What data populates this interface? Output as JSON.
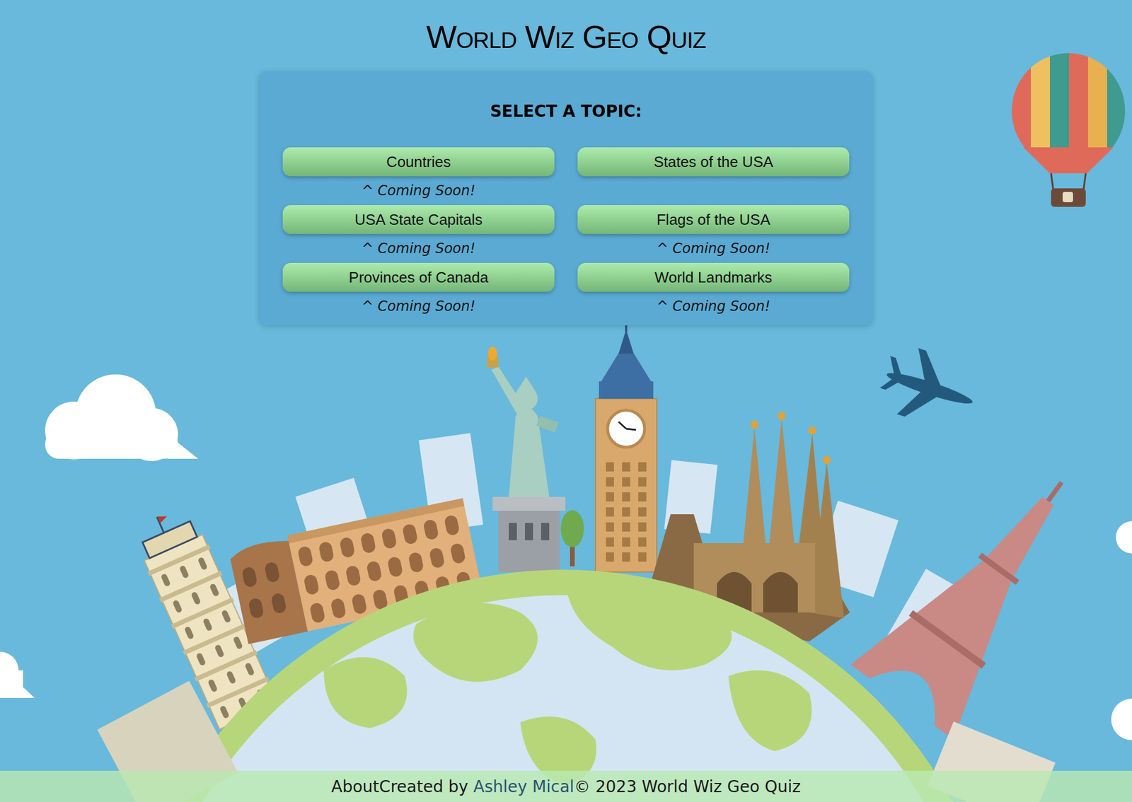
{
  "title": "World Wiz Geo Quiz",
  "topics": {
    "heading": "SELECT A TOPIC:",
    "items": [
      {
        "label": "Countries",
        "note": "^ Coming Soon!"
      },
      {
        "label": "States of the USA",
        "note": null
      },
      {
        "label": "USA State Capitals",
        "note": "^ Coming Soon!"
      },
      {
        "label": "Flags of the USA",
        "note": "^ Coming Soon!"
      },
      {
        "label": "Provinces of Canada",
        "note": "^ Coming Soon!"
      },
      {
        "label": "World Landmarks",
        "note": "^ Coming Soon!"
      }
    ]
  },
  "footer": {
    "about": "About",
    "created_by": "Created by",
    "author": "Ashley Mical",
    "copyright": "© 2023 World Wiz Geo Quiz"
  }
}
